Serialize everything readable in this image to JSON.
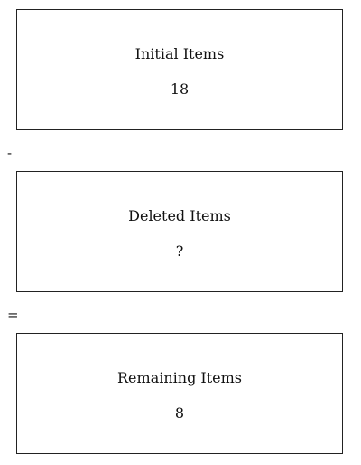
{
  "boxes": [
    {
      "label": "Initial Items",
      "value": "18"
    },
    {
      "label": "Deleted Items",
      "value": "?"
    },
    {
      "label": "Remaining Items",
      "value": "8"
    }
  ],
  "operators": {
    "minus": "-",
    "equals": "="
  }
}
